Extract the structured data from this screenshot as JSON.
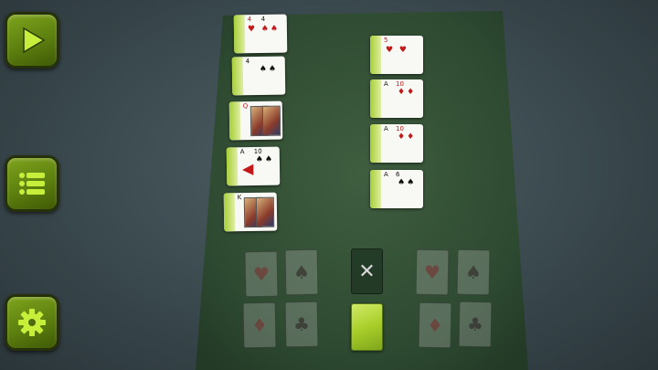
{
  "sidebar": {
    "buttons": [
      {
        "name": "play",
        "icon": "play-icon"
      },
      {
        "name": "menu",
        "icon": "list-icon"
      },
      {
        "name": "settings",
        "icon": "gear-icon"
      }
    ]
  },
  "colors": {
    "accent": "#7ea31c",
    "felt": "#2f4a32",
    "red_suit": "#c21818"
  },
  "tableau_left": [
    {
      "rank": "4",
      "suit": "hearts",
      "pips": "♥ ♠♠",
      "red": true
    },
    {
      "rank": "4",
      "suit": "spades",
      "pips": "♠♠",
      "red": false
    },
    {
      "rank": "Q",
      "suit": "diamonds",
      "pips": "♦",
      "red": true
    },
    {
      "rank": "10",
      "suit": "spades",
      "pips": "♠♠",
      "red": false
    },
    {
      "rank": "K",
      "suit": "spades",
      "pips": "",
      "red": false
    }
  ],
  "tableau_right": [
    {
      "rank": "5",
      "suit": "hearts",
      "pips": "♥ ♥",
      "red": true
    },
    {
      "rank": "10",
      "suit": "diamonds",
      "pips": "♦♦",
      "red": true
    },
    {
      "rank": "10",
      "suit": "diamonds",
      "pips": "♦♦",
      "red": true
    },
    {
      "rank": "6",
      "suit": "spades",
      "pips": "♠♠",
      "red": false
    }
  ],
  "foundations": [
    {
      "suit": "♥",
      "red": true
    },
    {
      "suit": "♠",
      "red": false
    },
    {
      "suit": "♦",
      "red": true
    },
    {
      "suit": "♣",
      "red": false
    },
    {
      "suit": "♥",
      "red": true
    },
    {
      "suit": "♠",
      "red": false
    },
    {
      "suit": "♦",
      "red": true
    },
    {
      "suit": "♣",
      "red": false
    }
  ],
  "reject_symbol": "✕"
}
